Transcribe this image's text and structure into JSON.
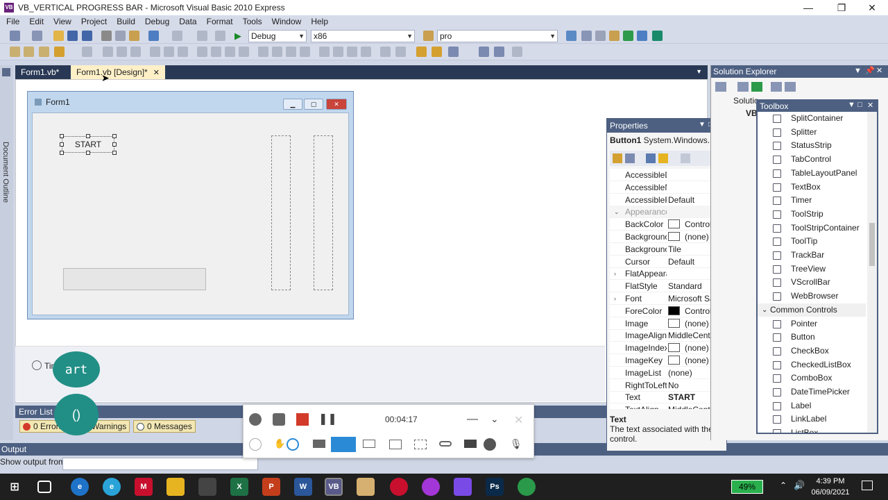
{
  "window": {
    "title": "VB_VERTICAL PROGRESS BAR - Microsoft Visual Basic 2010 Express",
    "minimize": "—",
    "maximize": "❐",
    "close": "✕"
  },
  "menu": [
    "File",
    "Edit",
    "View",
    "Project",
    "Build",
    "Debug",
    "Data",
    "Format",
    "Tools",
    "Window",
    "Help"
  ],
  "toolbar": {
    "config": "Debug",
    "platform": "x86",
    "find": "pro"
  },
  "left_strip": "Document Outline",
  "doc_tabs": [
    {
      "label": "Form1.vb*",
      "active": false
    },
    {
      "label": "Form1.vb [Design]*",
      "active": true,
      "close": "✕"
    }
  ],
  "form": {
    "title": "Form1",
    "button_text": "START"
  },
  "tray": {
    "component": "Timer1"
  },
  "overlay": {
    "bubble1": "art",
    "bubble2": "()"
  },
  "error_list": {
    "title": "Error List",
    "errors": "0 Errors",
    "warnings": "0 Warnings",
    "messages": "0 Messages"
  },
  "output": {
    "title": "Output",
    "show_from": "Show output from:"
  },
  "properties": {
    "title": "Properties",
    "object": "Button1",
    "object_type": "System.Windows.For",
    "rows": [
      {
        "name": "AccessibleD",
        "value": ""
      },
      {
        "name": "AccessibleN",
        "value": ""
      },
      {
        "name": "AccessibleR",
        "value": "Default"
      },
      {
        "name": "Appearance",
        "value": "",
        "category": true
      },
      {
        "name": "BackColor",
        "value": "Control",
        "swatch": "white"
      },
      {
        "name": "Backgrounc",
        "value": "(none)",
        "swatch": "white"
      },
      {
        "name": "Backgrounc",
        "value": "Tile"
      },
      {
        "name": "Cursor",
        "value": "Default"
      },
      {
        "name": "FlatAppeara",
        "value": "",
        "expand": true
      },
      {
        "name": "FlatStyle",
        "value": "Standard"
      },
      {
        "name": "Font",
        "value": "Microsoft San",
        "expand": true
      },
      {
        "name": "ForeColor",
        "value": "ControlT",
        "swatch": "black"
      },
      {
        "name": "Image",
        "value": "(none)",
        "swatch": "white"
      },
      {
        "name": "ImageAlign",
        "value": "MiddleCenter"
      },
      {
        "name": "ImageIndex",
        "value": "(none)",
        "swatch": "white"
      },
      {
        "name": "ImageKey",
        "value": "(none)",
        "swatch": "white"
      },
      {
        "name": "ImageList",
        "value": "(none)"
      },
      {
        "name": "RightToLeft",
        "value": "No"
      },
      {
        "name": "Text",
        "value": "START",
        "bold": true
      },
      {
        "name": "TextAlign",
        "value": "MiddleCenter"
      }
    ],
    "desc_title": "Text",
    "desc_body": "The text associated with the control."
  },
  "solution_explorer": {
    "title": "Solution Explorer",
    "item1": "Solutio",
    "item2": "VB"
  },
  "toolbox": {
    "title": "Toolbox",
    "items": [
      {
        "label": "SplitContainer",
        "icon": "split-container-icon"
      },
      {
        "label": "Splitter",
        "icon": "splitter-icon"
      },
      {
        "label": "StatusStrip",
        "icon": "status-strip-icon"
      },
      {
        "label": "TabControl",
        "icon": "tab-control-icon"
      },
      {
        "label": "TableLayoutPanel",
        "icon": "table-layout-icon"
      },
      {
        "label": "TextBox",
        "icon": "textbox-icon"
      },
      {
        "label": "Timer",
        "icon": "timer-icon"
      },
      {
        "label": "ToolStrip",
        "icon": "toolstrip-icon"
      },
      {
        "label": "ToolStripContainer",
        "icon": "toolstrip-container-icon"
      },
      {
        "label": "ToolTip",
        "icon": "tooltip-icon"
      },
      {
        "label": "TrackBar",
        "icon": "trackbar-icon"
      },
      {
        "label": "TreeView",
        "icon": "treeview-icon"
      },
      {
        "label": "VScrollBar",
        "icon": "vscrollbar-icon"
      },
      {
        "label": "WebBrowser",
        "icon": "webbrowser-icon"
      },
      {
        "label": "Common Controls",
        "header": true
      },
      {
        "label": "Pointer",
        "icon": "pointer-icon"
      },
      {
        "label": "Button",
        "icon": "button-icon"
      },
      {
        "label": "CheckBox",
        "icon": "checkbox-icon"
      },
      {
        "label": "CheckedListBox",
        "icon": "checkedlistbox-icon"
      },
      {
        "label": "ComboBox",
        "icon": "combobox-icon"
      },
      {
        "label": "DateTimePicker",
        "icon": "datetimepicker-icon"
      },
      {
        "label": "Label",
        "icon": "label-icon"
      },
      {
        "label": "LinkLabel",
        "icon": "linklabel-icon"
      },
      {
        "label": "ListBox",
        "icon": "listbox-icon"
      }
    ]
  },
  "recorder": {
    "time": "00:04:17"
  },
  "taskbar": {
    "battery": "49%",
    "time": "4:39 PM",
    "date": "06/09/2021"
  },
  "colors": {
    "vs_dark_blue": "#293955",
    "panel_title": "#4d6082",
    "tab_active": "#fff0c8",
    "teal": "#218f86"
  }
}
